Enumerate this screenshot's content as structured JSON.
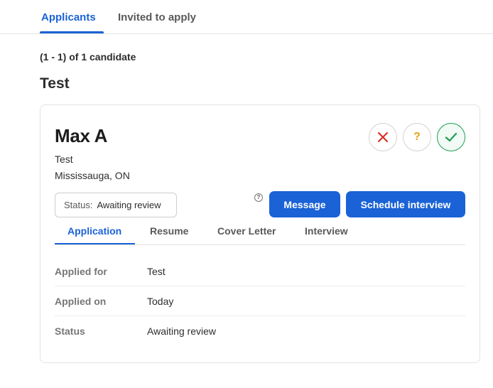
{
  "top_tabs": [
    {
      "label": "Applicants",
      "active": true
    },
    {
      "label": "Invited to apply",
      "active": false
    }
  ],
  "count_line": "(1 - 1) of 1 candidate",
  "job_title": "Test",
  "candidate": {
    "name": "Max A",
    "job": "Test",
    "location": "Mississauga, ON",
    "status_label": "Status:",
    "status_value": "Awaiting review"
  },
  "actions": {
    "reject_icon": "x-icon",
    "maybe_icon": "question-icon",
    "maybe_text": "?",
    "yes_icon": "check-icon",
    "help_text": "?",
    "message_label": "Message",
    "schedule_label": "Schedule interview"
  },
  "inner_tabs": [
    {
      "label": "Application",
      "active": true
    },
    {
      "label": "Resume",
      "active": false
    },
    {
      "label": "Cover Letter",
      "active": false
    },
    {
      "label": "Interview",
      "active": false
    }
  ],
  "details": [
    {
      "key": "Applied for",
      "value": "Test"
    },
    {
      "key": "Applied on",
      "value": "Today"
    },
    {
      "key": "Status",
      "value": "Awaiting review"
    }
  ],
  "colors": {
    "accent": "#1a62d6",
    "reject": "#d93025",
    "maybe": "#e8a317",
    "yes": "#1f9d55"
  }
}
